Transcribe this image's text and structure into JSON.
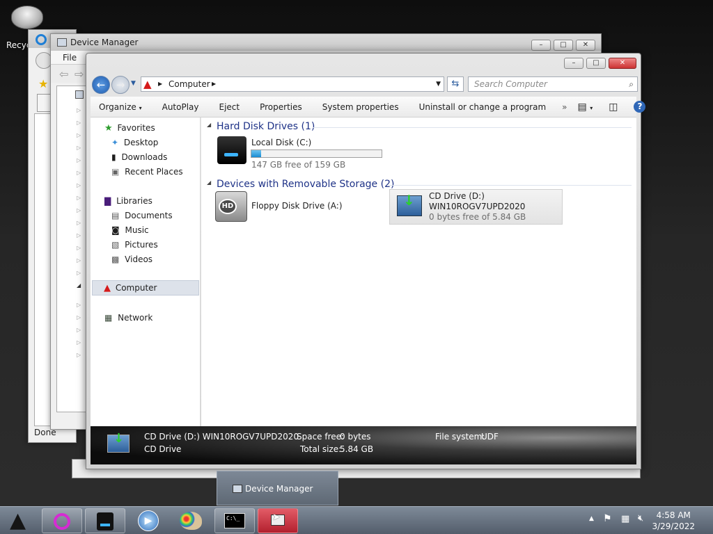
{
  "desktop": {
    "recycle_label": "Recyc"
  },
  "ie_window": {
    "status": "Done"
  },
  "device_manager_window": {
    "title": "Device Manager",
    "menu_file": "File"
  },
  "explorer": {
    "breadcrumb": "Computer",
    "search_placeholder": "Search Computer",
    "toolbar": {
      "organize": "Organize",
      "autoplay": "AutoPlay",
      "eject": "Eject",
      "properties": "Properties",
      "system_properties": "System properties",
      "uninstall": "Uninstall or change a program",
      "more": "»"
    },
    "nav": {
      "favorites": "Favorites",
      "desktop": "Desktop",
      "downloads": "Downloads",
      "recent": "Recent Places",
      "libraries": "Libraries",
      "documents": "Documents",
      "music": "Music",
      "pictures": "Pictures",
      "videos": "Videos",
      "computer": "Computer",
      "network": "Network"
    },
    "groups": {
      "hdd_title": "Hard Disk Drives (1)",
      "removable_title": "Devices with Removable Storage (2)"
    },
    "drives": {
      "local_c": {
        "name": "Local Disk (C:)",
        "free": "147 GB free of 159 GB",
        "used_fraction": 0.075
      },
      "floppy": {
        "name": "Floppy Disk Drive (A:)"
      },
      "cd": {
        "name": "CD Drive (D:)",
        "label": "WIN10ROGV7UPD2020",
        "free": "0 bytes free of 5.84 GB"
      }
    },
    "details": {
      "title": "CD Drive (D:) WIN10ROGV7UPD2020",
      "type": "CD Drive",
      "space_free_label": "Space free:",
      "space_free": "0 bytes",
      "total_size_label": "Total size:",
      "total_size": "5.84 GB",
      "fs_label": "File system:",
      "fs": "UDF"
    }
  },
  "taskbar_preview": {
    "label": "Device Manager"
  },
  "clock": {
    "time": "4:58 AM",
    "date": "3/29/2022"
  }
}
